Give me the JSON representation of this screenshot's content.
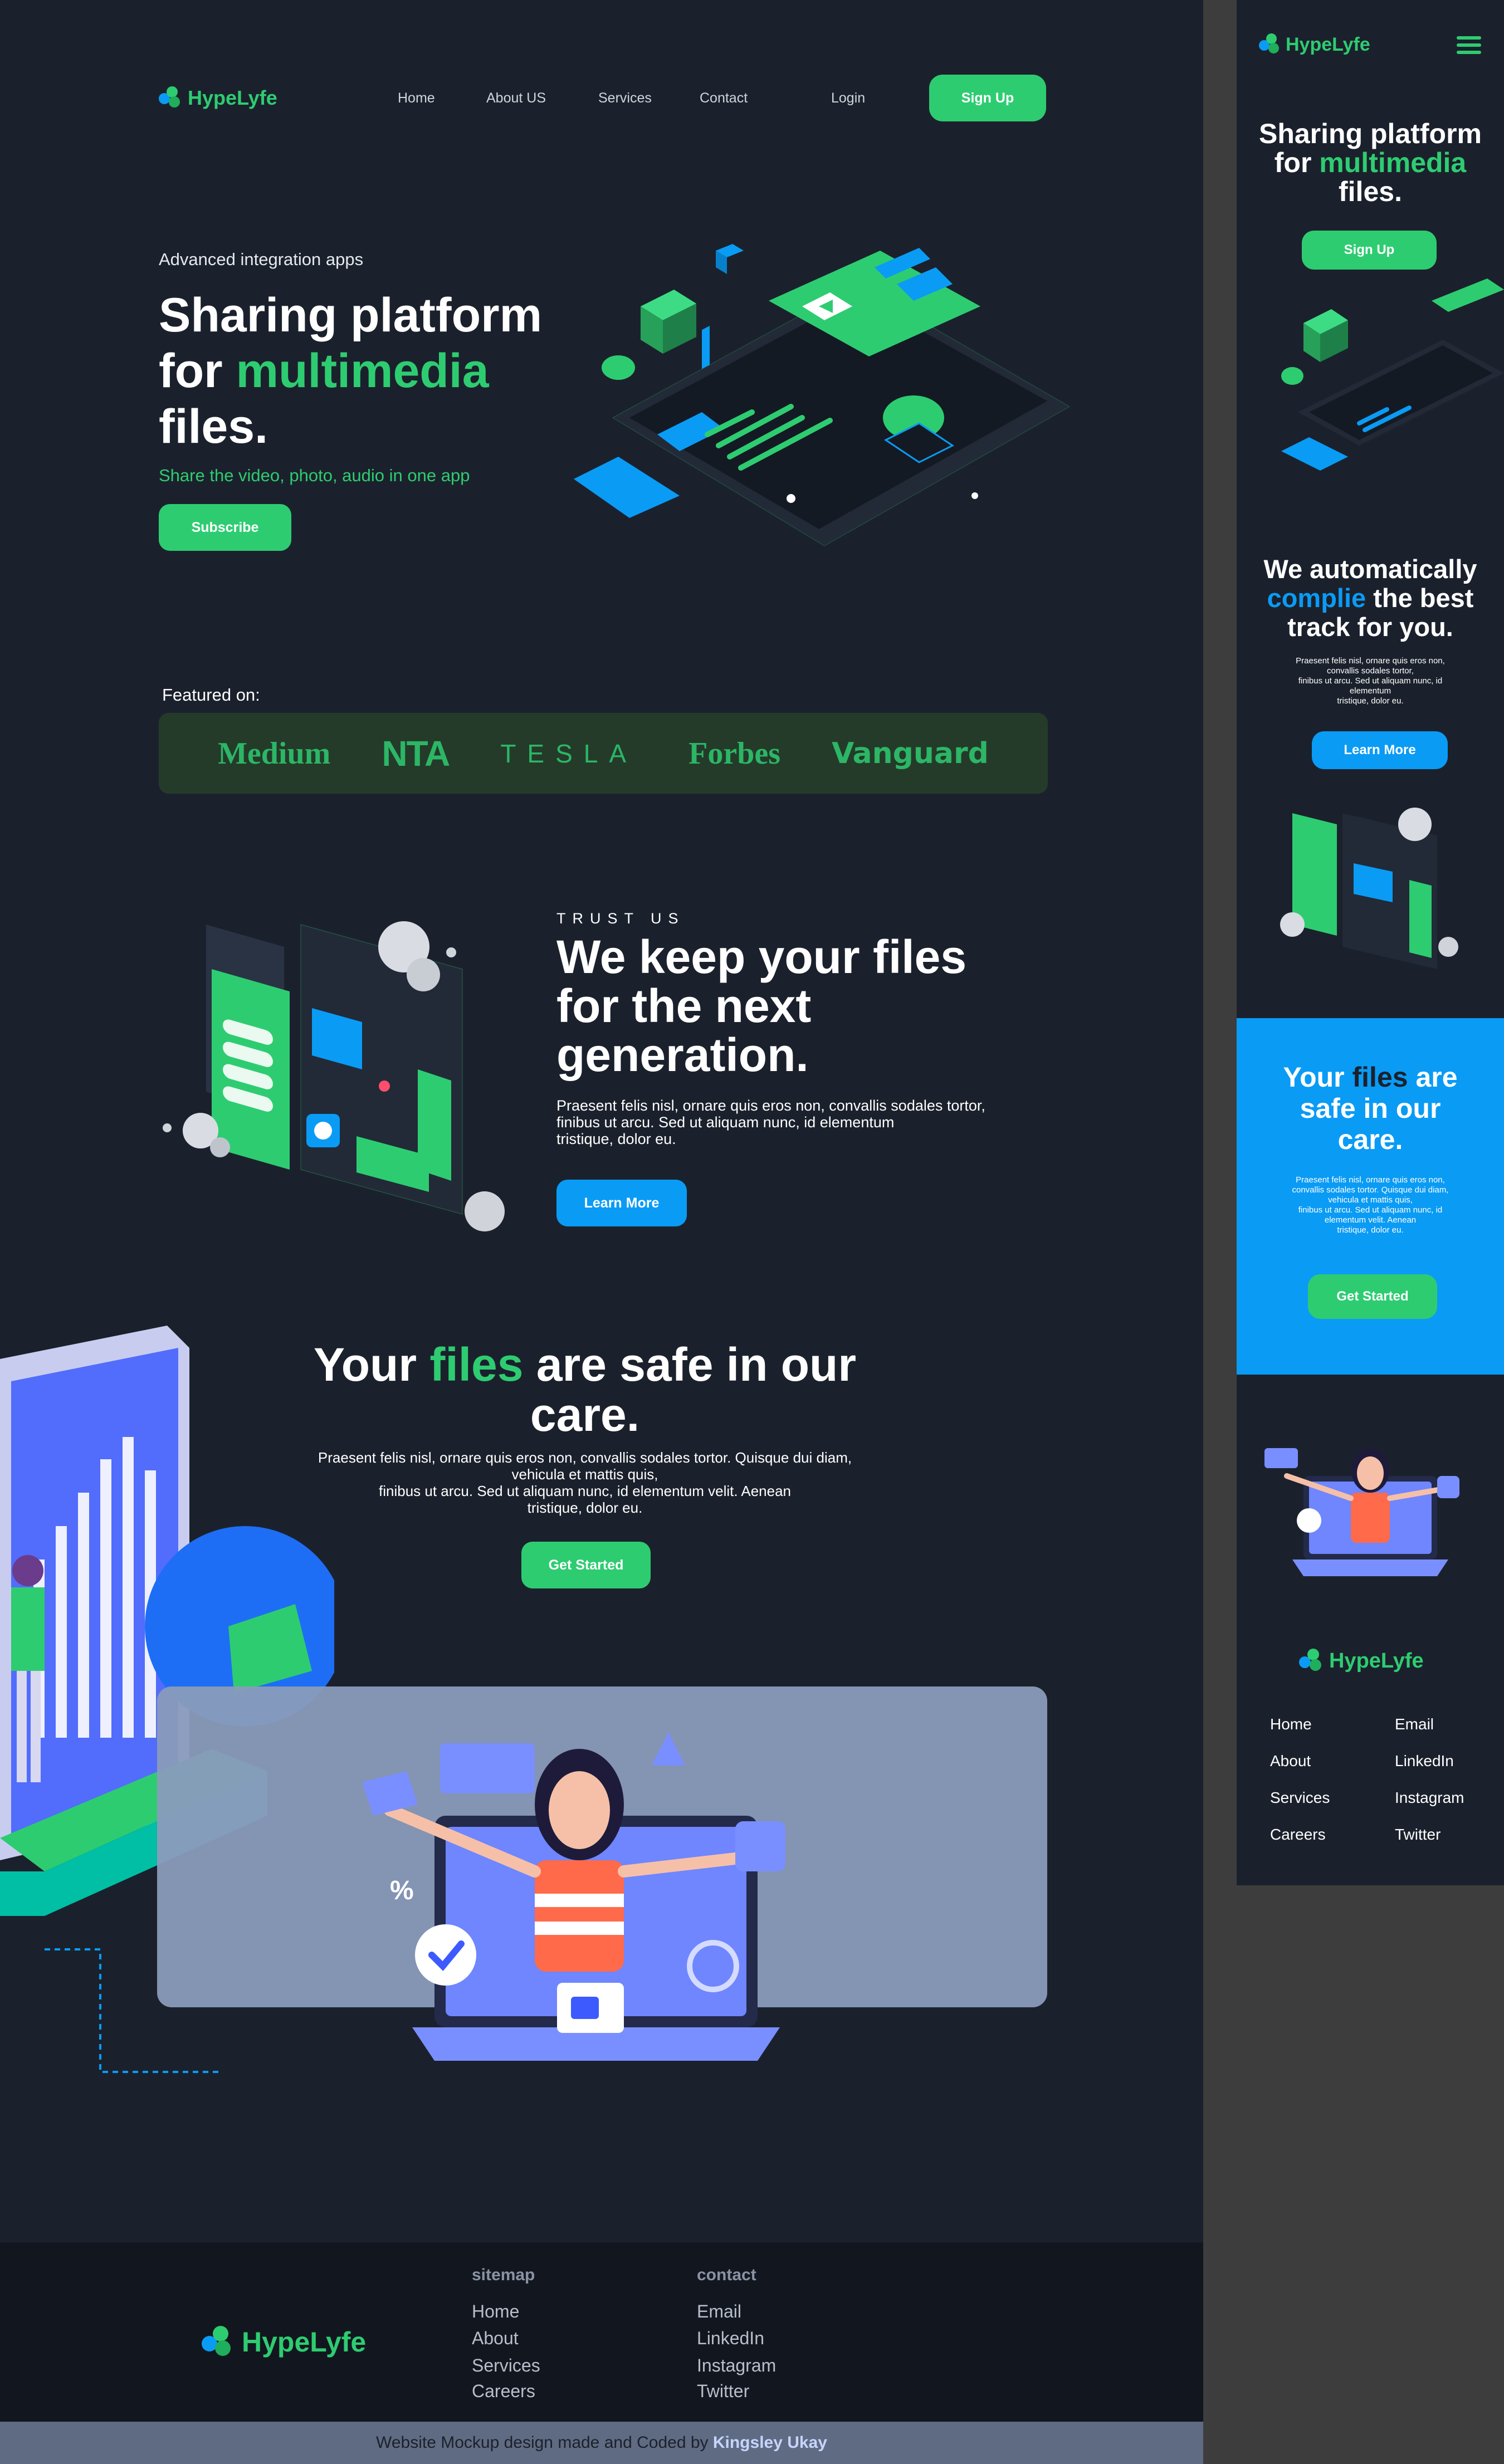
{
  "brand": {
    "name": "HypeLyfe"
  },
  "nav": {
    "links": [
      "Home",
      "About US",
      "Services",
      "Contact"
    ],
    "login": "Login",
    "signup": "Sign Up"
  },
  "hero": {
    "eyebrow": "Advanced integration apps",
    "title_line1": "Sharing platform",
    "title_line2_pre": "for ",
    "title_line2_accent": "multimedia",
    "title_line3": "files.",
    "subtitle": "Share the video, photo, audio in one app",
    "cta": "Subscribe"
  },
  "featured": {
    "label": "Featured on:",
    "brands": [
      "Medium",
      "NTA",
      "TESLA",
      "Forbes",
      "Vanguard"
    ]
  },
  "trust": {
    "eyebrow": "TRUST US",
    "title_line1": "We keep your files",
    "title_line2": "for the next",
    "title_line3": "generation.",
    "body_line1": "Praesent felis nisl, ornare quis eros non, convallis sodales tortor,",
    "body_line2": "finibus ut arcu. Sed ut aliquam nunc, id elementum",
    "body_line3": "tristique, dolor eu.",
    "cta": "Learn More"
  },
  "safe": {
    "title_pre": "Your ",
    "title_accent": "files",
    "title_post": " are safe in our",
    "title_line2": "care.",
    "body_line1": "Praesent felis nisl, ornare quis eros non, convallis sodales tortor. Quisque dui diam,",
    "body_line2": "vehicula et mattis quis,",
    "body_line3": "finibus ut arcu. Sed ut aliquam nunc, id elementum velit.  Aenean",
    "body_line4": "tristique, dolor eu.",
    "cta": "Get Started"
  },
  "footer": {
    "sitemap_head": "sitemap",
    "sitemap": [
      "Home",
      "About",
      "Services",
      "Careers"
    ],
    "contact_head": "contact",
    "contact": [
      "Email",
      "LinkedIn",
      "Instagram",
      "Twitter"
    ],
    "credit_pre": "Website Mockup design made and Coded by ",
    "credit_name": "Kingsley Ukay"
  },
  "mobile": {
    "hero_line1": "Sharing platform",
    "hero_line2_pre": "for ",
    "hero_line2_accent": "multimedia",
    "hero_line3": "files.",
    "signup": "Sign Up",
    "compile_line1": "We automatically",
    "compile_accent": "complie",
    "compile_line2_post": " the best",
    "compile_line3": "track for you.",
    "compile_body_1": "Praesent felis nisl, ornare quis eros non,",
    "compile_body_2": "convallis sodales tortor,",
    "compile_body_3": "finibus ut arcu. Sed ut aliquam nunc, id",
    "compile_body_4": "elementum",
    "compile_body_5": "tristique, dolor eu.",
    "learn_more": "Learn More",
    "safe_pre": "Your ",
    "safe_accent": "files",
    "safe_post": " are",
    "safe_line2": "safe in our",
    "safe_line3": "care.",
    "safe_body_1": "Praesent felis nisl, ornare quis eros non,",
    "safe_body_2": "convallis sodales tortor. Quisque dui diam,",
    "safe_body_3": "vehicula et mattis quis,",
    "safe_body_4": "finibus ut arcu. Sed ut aliquam nunc, id",
    "safe_body_5": "elementum velit.  Aenean",
    "safe_body_6": "tristique, dolor eu.",
    "get_started": "Get Started",
    "foot_left": [
      "Home",
      "About",
      "Services",
      "Careers"
    ],
    "foot_right": [
      "Email",
      "LinkedIn",
      "Instagram",
      "Twitter"
    ]
  },
  "colors": {
    "background": "#1b212c",
    "accent_green": "#2ecc71",
    "accent_blue": "#0a9bf5",
    "footer_bg": "#12171f",
    "credit_bar": "#5f6b82",
    "outer_gray": "#3d3d3d"
  }
}
